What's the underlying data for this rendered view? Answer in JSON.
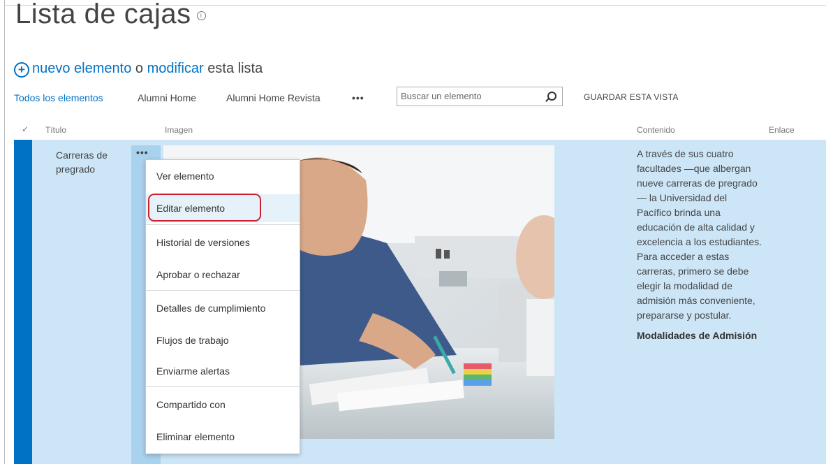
{
  "page": {
    "title": "Lista de cajas",
    "info_glyph": "i"
  },
  "new_item": {
    "plus_glyph": "+",
    "new_link": "nuevo elemento",
    "connector": " o ",
    "edit_link": "modificar",
    "suffix": " esta lista"
  },
  "views": {
    "items": [
      "Todos los elementos",
      "Alumni Home",
      "Alumni Home Revista"
    ],
    "more": "•••",
    "search_placeholder": "Buscar un elemento",
    "save_view": "GUARDAR ESTA VISTA"
  },
  "columns": {
    "check": "✓",
    "titulo": "Título",
    "imagen": "Imagen",
    "contenido": "Contenido",
    "enlace": "Enlace"
  },
  "row": {
    "title": "Carreras de pregrado",
    "ellipsis": "•••",
    "content_paragraph": "A través de sus cuatro facultades —que albergan nueve carreras de pregrado— la Universidad del Pacífico brinda una educación de alta calidad y excelencia a los estudiantes. Para acceder a estas carreras, primero se debe elegir la modalidad de admisión más conveniente, prepararse y postular.",
    "content_heading": "Modalidades de Admisión"
  },
  "context_menu": {
    "items": [
      "Ver elemento",
      "Editar elemento",
      "Historial de versiones",
      "Aprobar o rechazar",
      "Detalles de cumplimiento",
      "Flujos de trabajo",
      "Enviarme alertas",
      "Compartido con",
      "Eliminar elemento"
    ],
    "highlighted": "Editar elemento"
  },
  "colors": {
    "accent": "#0072c6",
    "row_selected": "#cde6f7",
    "highlight_oval": "#d02030"
  },
  "icons": {
    "title_info": "info-circle-icon",
    "new_item": "plus-circle-icon",
    "search": "search-icon",
    "column_check": "checkmark-icon"
  }
}
